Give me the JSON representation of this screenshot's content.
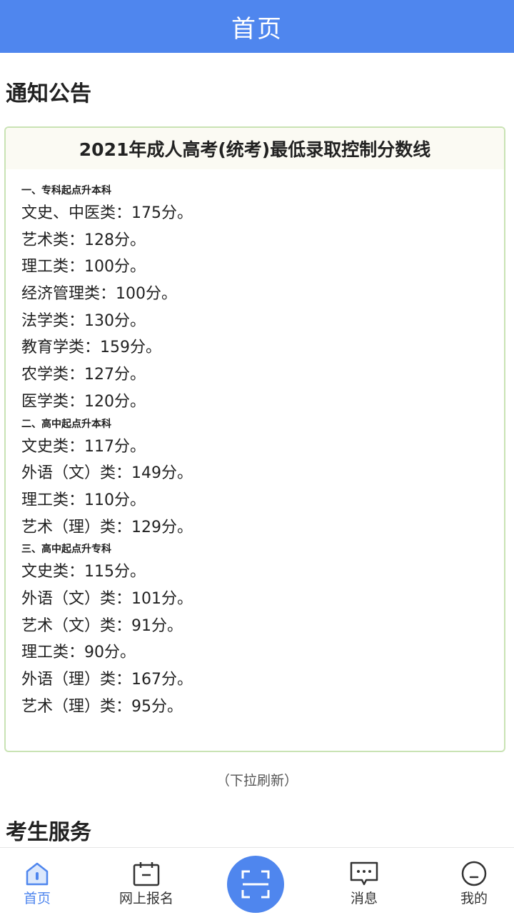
{
  "header": {
    "title": "首页"
  },
  "notice_section": {
    "title": "通知公告",
    "card": {
      "title": "2021年成人高考(统考)最低录取控制分数线",
      "groups": [
        {
          "heading": "一、专科起点升本科",
          "items": [
            "文史、中医类：175分。",
            "艺术类：128分。",
            "理工类：100分。",
            "经济管理类：100分。",
            "法学类：130分。",
            "教育学类：159分。",
            "农学类：127分。",
            "医学类：120分。"
          ]
        },
        {
          "heading": "二、高中起点升本科",
          "items": [
            "文史类：117分。",
            "外语（文）类：149分。",
            "理工类：110分。",
            "艺术（理）类：129分。"
          ]
        },
        {
          "heading": "三、高中起点升专科",
          "items": [
            "文史类：115分。",
            "外语（文）类：101分。",
            "艺术（文）类：91分。",
            "理工类：90分。",
            "外语（理）类：167分。",
            "艺术（理）类：95分。"
          ]
        }
      ]
    },
    "refresh_hint": "（下拉刷新）"
  },
  "service_section": {
    "title": "考生服务"
  },
  "tabbar": {
    "tabs": [
      {
        "label": "首页",
        "icon": "home-icon",
        "active": true
      },
      {
        "label": "网上报名",
        "icon": "calendar-icon",
        "active": false
      },
      {
        "label": "消息",
        "icon": "message-icon",
        "active": false
      },
      {
        "label": "我的",
        "icon": "profile-icon",
        "active": false
      }
    ],
    "center_button_icon": "scan-icon"
  },
  "colors": {
    "primary": "#4f86ee",
    "card_border": "#c9e3b4",
    "card_header_bg": "#fbfaf3"
  }
}
